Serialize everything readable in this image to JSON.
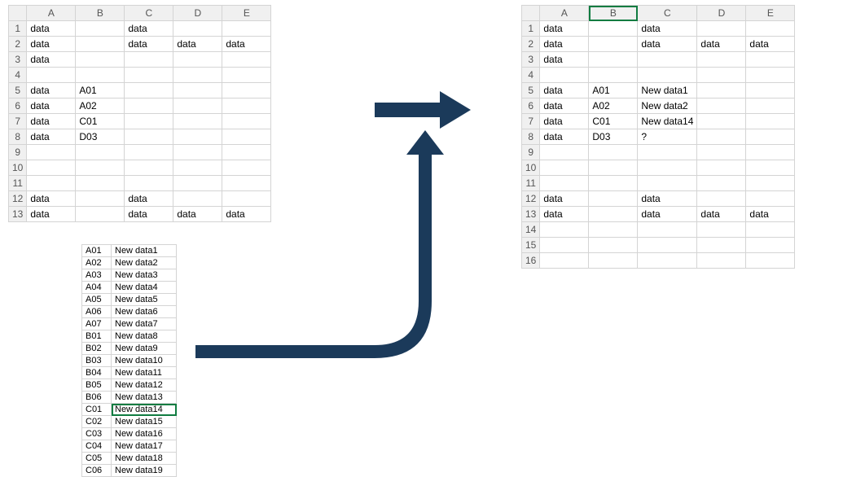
{
  "columns": [
    "A",
    "B",
    "C",
    "D",
    "E"
  ],
  "left_sheet": {
    "rows": [
      {
        "n": "1",
        "A": "data",
        "B": "",
        "C": "data",
        "D": "",
        "E": ""
      },
      {
        "n": "2",
        "A": "data",
        "B": "",
        "C": "data",
        "D": "data",
        "E": "data"
      },
      {
        "n": "3",
        "A": "data",
        "B": "",
        "C": "",
        "D": "",
        "E": ""
      },
      {
        "n": "4",
        "A": "",
        "B": "",
        "C": "",
        "D": "",
        "E": ""
      },
      {
        "n": "5",
        "A": "data",
        "B": "A01",
        "C": "",
        "D": "",
        "E": ""
      },
      {
        "n": "6",
        "A": "data",
        "B": "A02",
        "C": "",
        "D": "",
        "E": ""
      },
      {
        "n": "7",
        "A": "data",
        "B": "C01",
        "C": "",
        "D": "",
        "E": ""
      },
      {
        "n": "8",
        "A": "data",
        "B": "D03",
        "C": "",
        "D": "",
        "E": ""
      },
      {
        "n": "9",
        "A": "",
        "B": "",
        "C": "",
        "D": "",
        "E": ""
      },
      {
        "n": "10",
        "A": "",
        "B": "",
        "C": "",
        "D": "",
        "E": ""
      },
      {
        "n": "11",
        "A": "",
        "B": "",
        "C": "",
        "D": "",
        "E": ""
      },
      {
        "n": "12",
        "A": "data",
        "B": "",
        "C": "data",
        "D": "",
        "E": ""
      },
      {
        "n": "13",
        "A": "data",
        "B": "",
        "C": "data",
        "D": "data",
        "E": "data"
      }
    ]
  },
  "right_sheet": {
    "selected_col": "B",
    "rows": [
      {
        "n": "1",
        "A": "data",
        "B": "",
        "C": "data",
        "D": "",
        "E": ""
      },
      {
        "n": "2",
        "A": "data",
        "B": "",
        "C": "data",
        "D": "data",
        "E": "data"
      },
      {
        "n": "3",
        "A": "data",
        "B": "",
        "C": "",
        "D": "",
        "E": ""
      },
      {
        "n": "4",
        "A": "",
        "B": "",
        "C": "",
        "D": "",
        "E": ""
      },
      {
        "n": "5",
        "A": "data",
        "B": "A01",
        "C": "New data1",
        "D": "",
        "E": ""
      },
      {
        "n": "6",
        "A": "data",
        "B": "A02",
        "C": "New data2",
        "D": "",
        "E": ""
      },
      {
        "n": "7",
        "A": "data",
        "B": "C01",
        "C": "New data14",
        "D": "",
        "E": ""
      },
      {
        "n": "8",
        "A": "data",
        "B": "D03",
        "C": "?",
        "D": "",
        "E": ""
      },
      {
        "n": "9",
        "A": "",
        "B": "",
        "C": "",
        "D": "",
        "E": ""
      },
      {
        "n": "10",
        "A": "",
        "B": "",
        "C": "",
        "D": "",
        "E": ""
      },
      {
        "n": "11",
        "A": "",
        "B": "",
        "C": "",
        "D": "",
        "E": ""
      },
      {
        "n": "12",
        "A": "data",
        "B": "",
        "C": "data",
        "D": "",
        "E": ""
      },
      {
        "n": "13",
        "A": "data",
        "B": "",
        "C": "data",
        "D": "data",
        "E": "data"
      },
      {
        "n": "14",
        "A": "",
        "B": "",
        "C": "",
        "D": "",
        "E": ""
      },
      {
        "n": "15",
        "A": "",
        "B": "",
        "C": "",
        "D": "",
        "E": ""
      },
      {
        "n": "16",
        "A": "",
        "B": "",
        "C": "",
        "D": "",
        "E": ""
      }
    ]
  },
  "lookup_table": {
    "selected_row": 13,
    "rows": [
      {
        "k": "A01",
        "v": "New data1"
      },
      {
        "k": "A02",
        "v": "New data2"
      },
      {
        "k": "A03",
        "v": "New data3"
      },
      {
        "k": "A04",
        "v": "New data4"
      },
      {
        "k": "A05",
        "v": "New data5"
      },
      {
        "k": "A06",
        "v": "New data6"
      },
      {
        "k": "A07",
        "v": "New data7"
      },
      {
        "k": "B01",
        "v": "New data8"
      },
      {
        "k": "B02",
        "v": "New data9"
      },
      {
        "k": "B03",
        "v": "New data10"
      },
      {
        "k": "B04",
        "v": "New data11"
      },
      {
        "k": "B05",
        "v": "New data12"
      },
      {
        "k": "B06",
        "v": "New data13"
      },
      {
        "k": "C01",
        "v": "New data14"
      },
      {
        "k": "C02",
        "v": "New data15"
      },
      {
        "k": "C03",
        "v": "New data16"
      },
      {
        "k": "C04",
        "v": "New data17"
      },
      {
        "k": "C05",
        "v": "New data18"
      },
      {
        "k": "C06",
        "v": "New data19"
      }
    ]
  },
  "arrow_color": "#1b3a5a"
}
